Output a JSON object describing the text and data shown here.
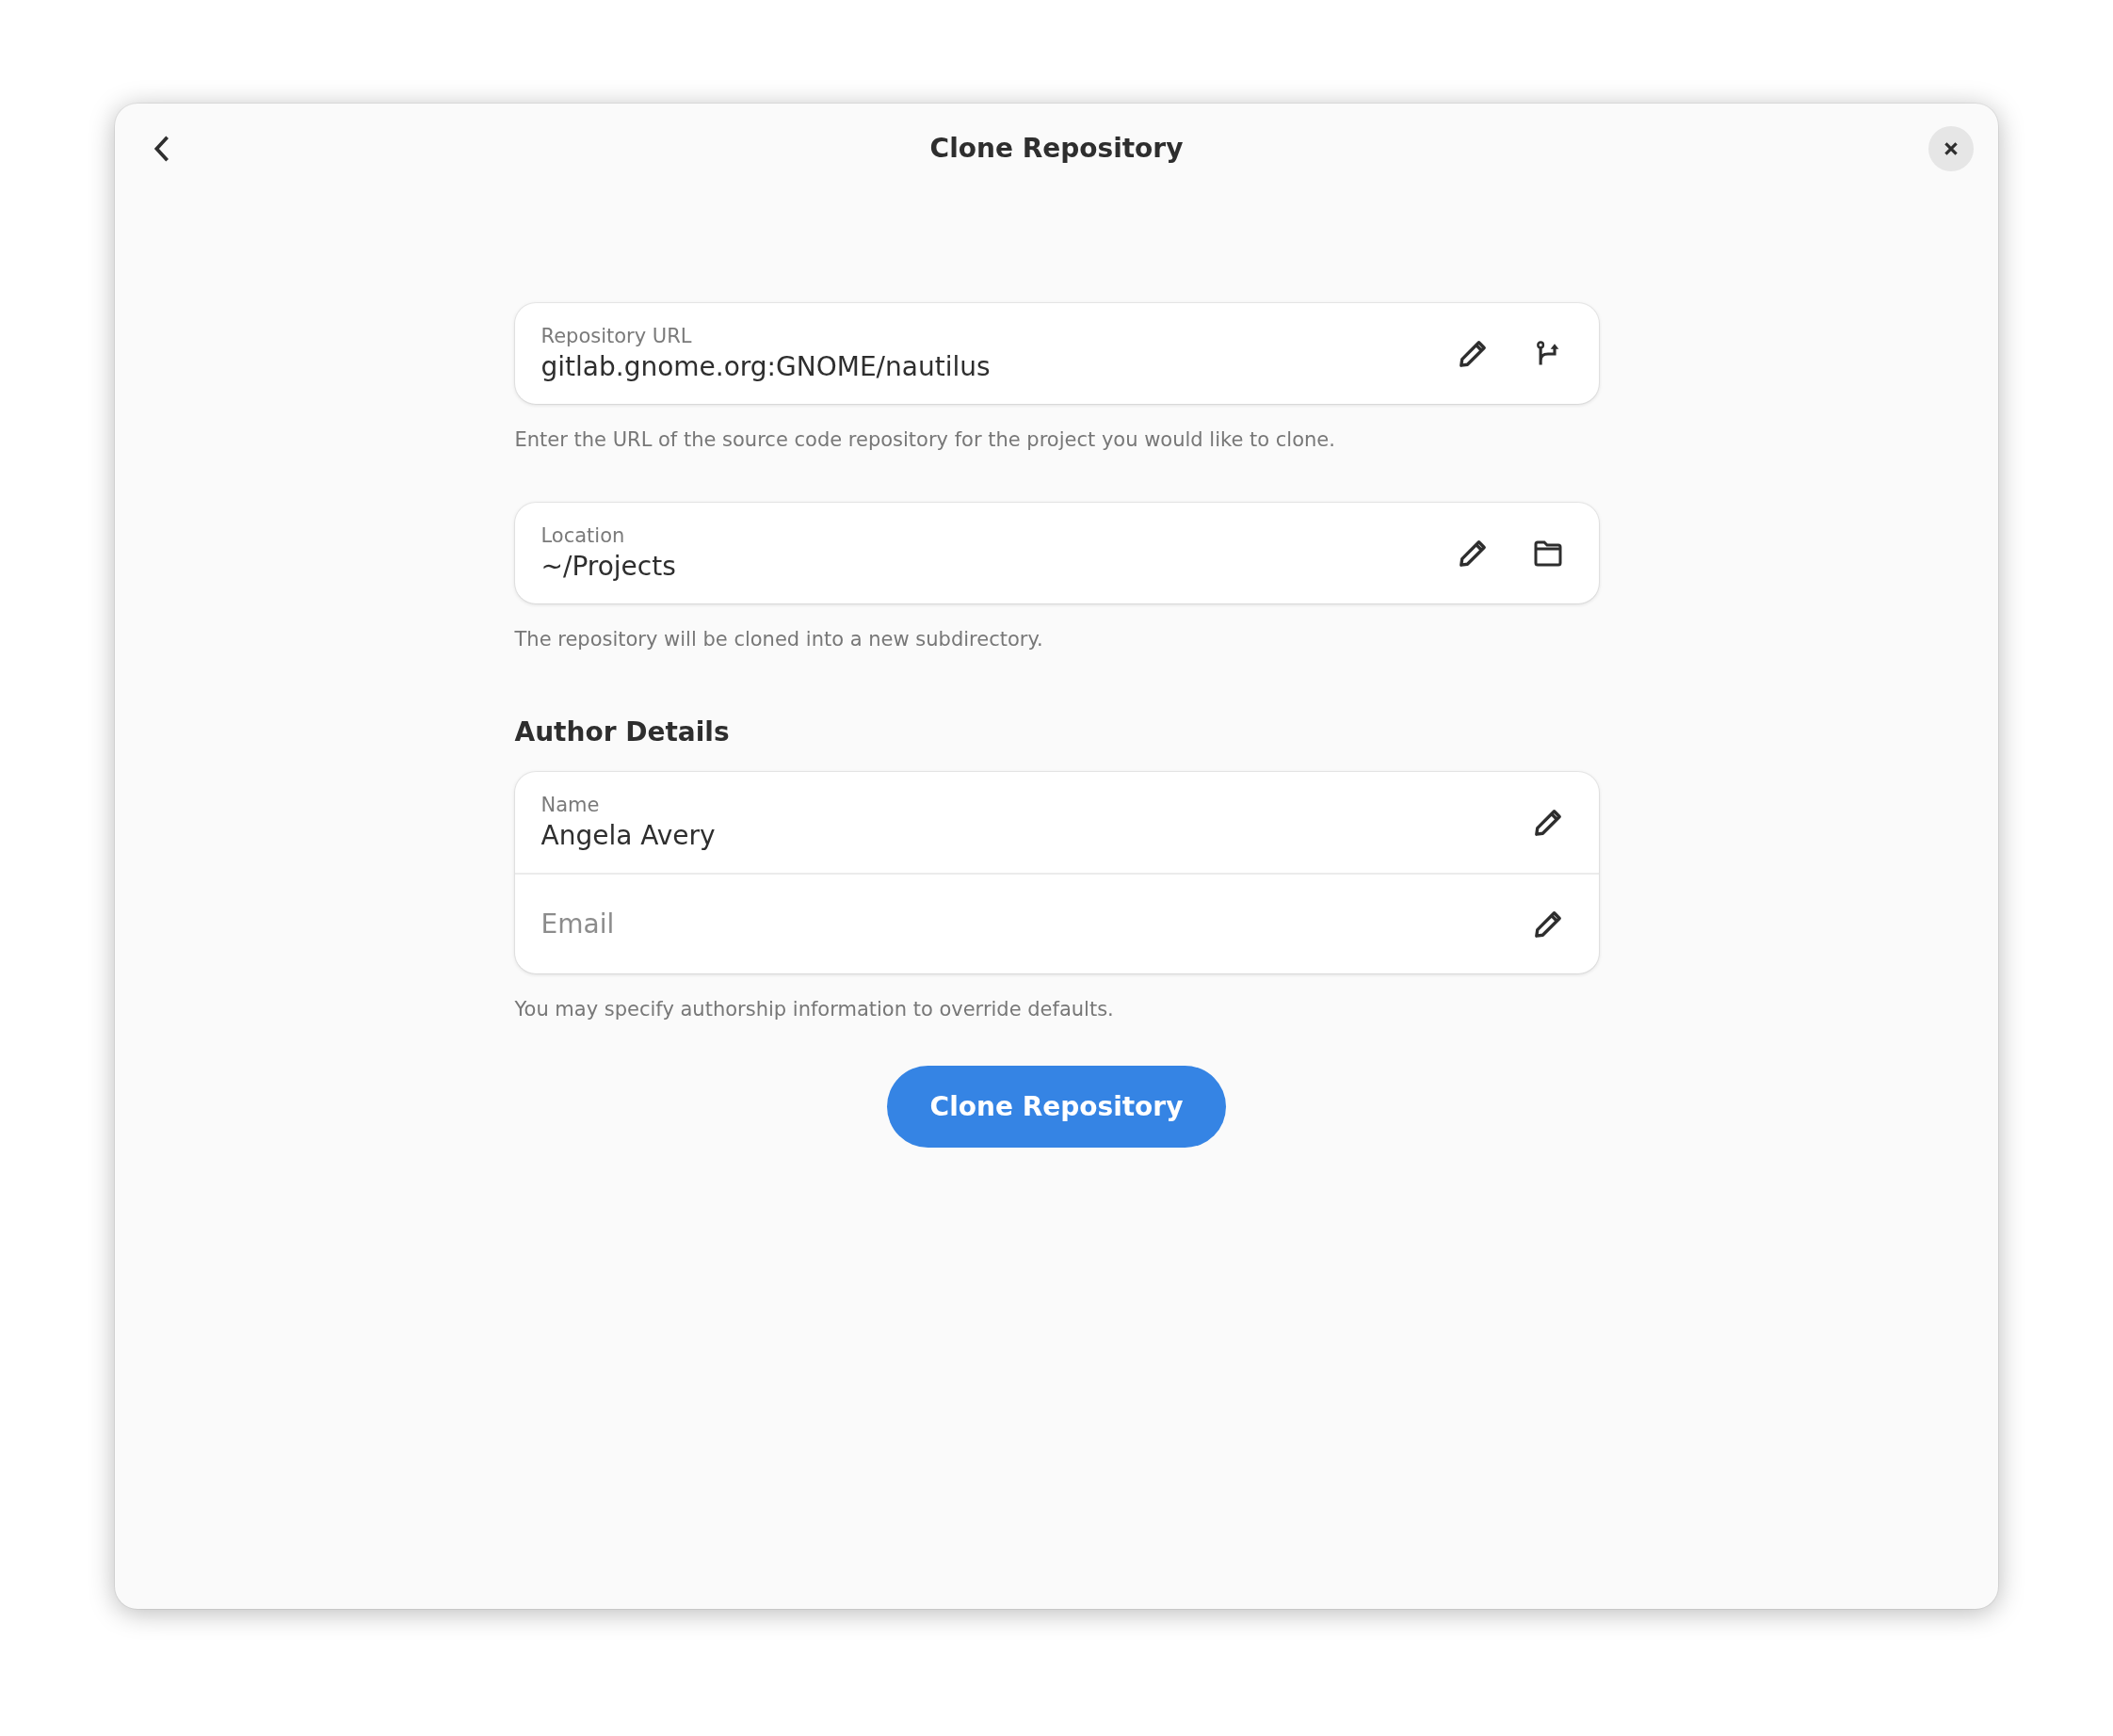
{
  "window": {
    "title": "Clone Repository"
  },
  "fields": [
    {
      "label": "Repository URL",
      "value": "gitlab.gnome.org:GNOME/nautilus",
      "kind": "branch",
      "hint": "Enter the URL of the source code repository for the project you would like to clone."
    },
    {
      "label": "Location",
      "value": "~/Projects",
      "kind": "folder",
      "hint": "The repository will be cloned into a new subdirectory."
    }
  ],
  "author": {
    "heading": "Author Details",
    "rows": [
      {
        "label": "Name",
        "value": "Angela Avery"
      },
      {
        "placeholder": "Email"
      }
    ],
    "hint": "You may specify authorship information to override defaults."
  },
  "primary_button": "Clone Repository"
}
